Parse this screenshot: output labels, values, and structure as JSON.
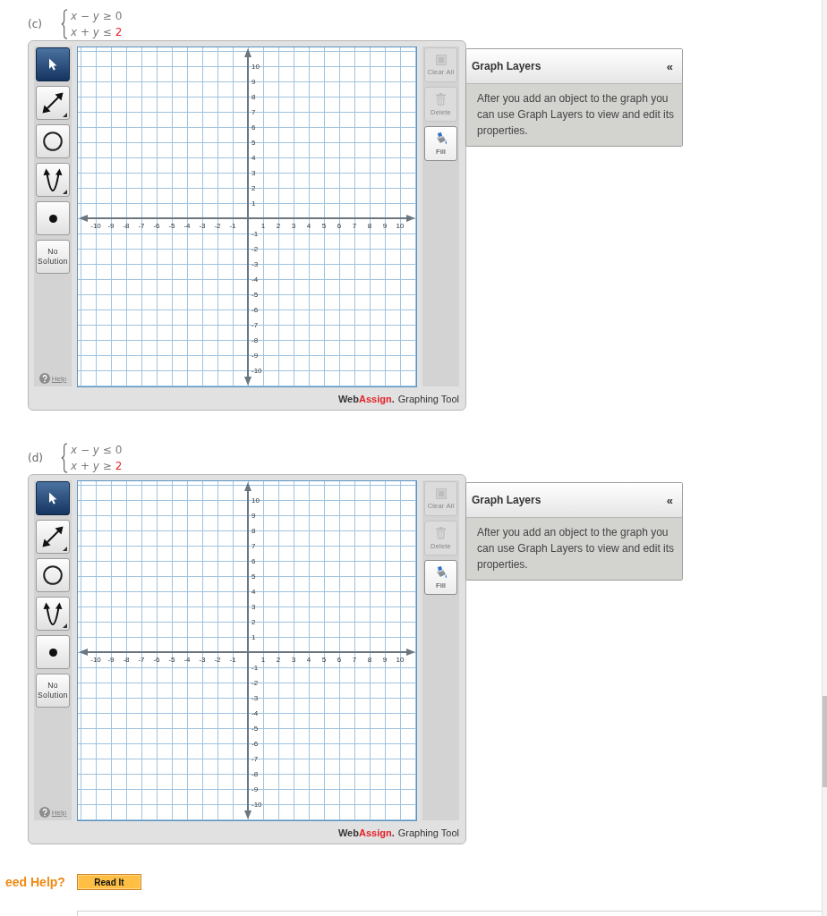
{
  "problems": [
    {
      "label": "(c)",
      "system": [
        {
          "expression": "*x* − *y* ≥",
          "value": "0",
          "value_highlighted": false
        },
        {
          "expression": "*x* + *y* ≤",
          "value": "2",
          "value_highlighted": true
        }
      ],
      "graphing_tool": {
        "tools": [
          {
            "kind": "pointer",
            "selected": true,
            "has_menu": false
          },
          {
            "kind": "line",
            "selected": false,
            "has_menu": true
          },
          {
            "kind": "circle",
            "selected": false,
            "has_menu": false
          },
          {
            "kind": "parabola",
            "selected": false,
            "has_menu": true
          },
          {
            "kind": "point",
            "selected": false,
            "has_menu": false
          },
          {
            "kind": "label",
            "label": "No Solution",
            "selected": false,
            "has_menu": false
          }
        ],
        "help_link": "Help",
        "x_tick_labels": [
          "-10",
          "-9",
          "-8",
          "-7",
          "-6",
          "-5",
          "-4",
          "-3",
          "-2",
          "-1",
          "1",
          "2",
          "3",
          "4",
          "5",
          "6",
          "7",
          "8",
          "9",
          "10"
        ],
        "y_tick_labels": [
          "10",
          "9",
          "8",
          "7",
          "6",
          "5",
          "4",
          "3",
          "2",
          "1",
          "-1",
          "-2",
          "-3",
          "-4",
          "-5",
          "-6",
          "-7",
          "-8",
          "-9",
          "-10"
        ],
        "actions": [
          {
            "kind": "clear",
            "label": "Clear All",
            "disabled": true
          },
          {
            "kind": "delete",
            "label": "Delete",
            "disabled": true
          },
          {
            "kind": "fill",
            "label": "Fill",
            "disabled": false
          }
        ],
        "footer": {
          "logo_start": "Web",
          "logo_accent": "Assign",
          "logo_end": ".",
          "product": "Graphing Tool"
        }
      },
      "graph_layers": {
        "title": "Graph Layers",
        "toggle": "«",
        "message": "After you add an object to the graph you can use Graph Layers to view and edit its properties."
      }
    },
    {
      "label": "(d)",
      "system": [
        {
          "expression": "*x* − *y* ≤",
          "value": "0",
          "value_highlighted": false
        },
        {
          "expression": "*x* + *y* ≥",
          "value": "2",
          "value_highlighted": true
        }
      ],
      "graphing_tool": {
        "tools": [
          {
            "kind": "pointer",
            "selected": true,
            "has_menu": false
          },
          {
            "kind": "line",
            "selected": false,
            "has_menu": true
          },
          {
            "kind": "circle",
            "selected": false,
            "has_menu": false
          },
          {
            "kind": "parabola",
            "selected": false,
            "has_menu": true
          },
          {
            "kind": "point",
            "selected": false,
            "has_menu": false
          },
          {
            "kind": "label",
            "label": "No Solution",
            "selected": false,
            "has_menu": false
          }
        ],
        "help_link": "Help",
        "x_tick_labels": [
          "-10",
          "-9",
          "-8",
          "-7",
          "-6",
          "-5",
          "-4",
          "-3",
          "-2",
          "-1",
          "1",
          "2",
          "3",
          "4",
          "5",
          "6",
          "7",
          "8",
          "9",
          "10"
        ],
        "y_tick_labels": [
          "10",
          "9",
          "8",
          "7",
          "6",
          "5",
          "4",
          "3",
          "2",
          "1",
          "-1",
          "-2",
          "-3",
          "-4",
          "-5",
          "-6",
          "-7",
          "-8",
          "-9",
          "-10"
        ],
        "actions": [
          {
            "kind": "clear",
            "label": "Clear All",
            "disabled": true
          },
          {
            "kind": "delete",
            "label": "Delete",
            "disabled": true
          },
          {
            "kind": "fill",
            "label": "Fill",
            "disabled": false
          }
        ],
        "footer": {
          "logo_start": "Web",
          "logo_accent": "Assign",
          "logo_end": ".",
          "product": "Graphing Tool"
        }
      },
      "graph_layers": {
        "title": "Graph Layers",
        "toggle": "«",
        "message": "After you add an object to the graph you can use Graph Layers to view and edit its properties."
      }
    }
  ],
  "need_help": {
    "label": "eed Help?",
    "button": "Read It"
  }
}
